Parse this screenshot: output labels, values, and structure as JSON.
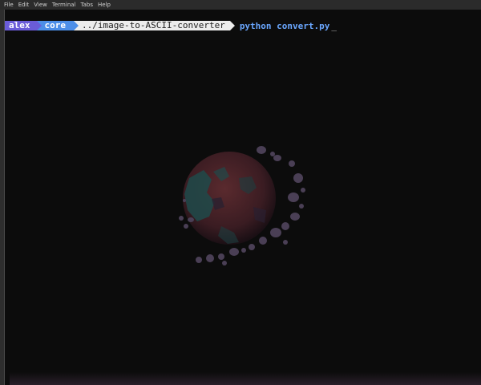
{
  "menubar": {
    "items": [
      "File",
      "Edit",
      "View",
      "Terminal",
      "Tabs",
      "Help"
    ]
  },
  "prompt": {
    "user": "alex",
    "branch": "core",
    "path": "../image-to-ASCII-converter",
    "command": "python convert.py",
    "cursor": "_"
  },
  "colors": {
    "user_segment": "#6a5cd8",
    "branch_segment": "#4c8ee8",
    "path_segment": "#ececec",
    "command_text": "#6aa7ff",
    "terminal_background": "#0c0c0c"
  },
  "icons": {
    "ascii_render": "planet-with-asteroids-icon"
  }
}
